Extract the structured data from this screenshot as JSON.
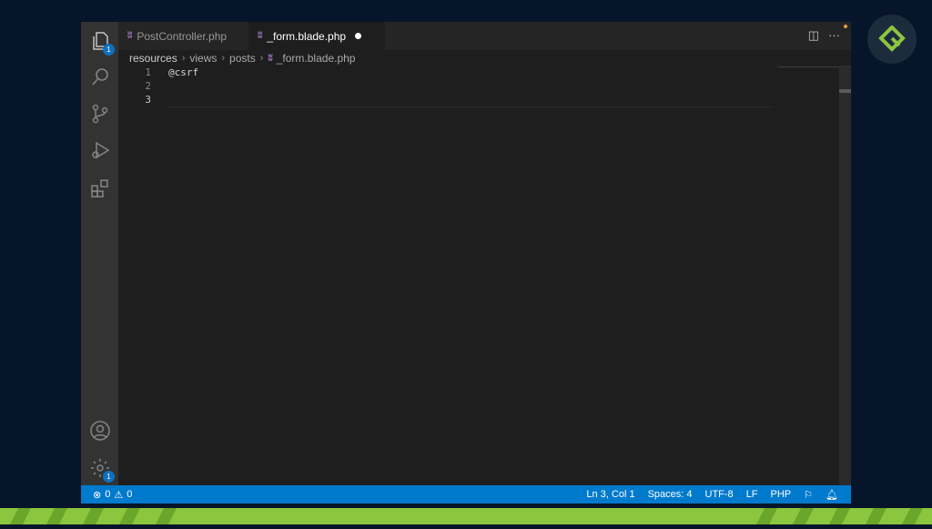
{
  "tabs": [
    {
      "icon": "php-elephant-icon",
      "label": "PostController.php",
      "active": false
    },
    {
      "icon": "php-elephant-icon",
      "label": "_form.blade.php",
      "active": true,
      "dirty": true
    }
  ],
  "breadcrumb": [
    "resources",
    "views",
    "posts",
    "_form.blade.php"
  ],
  "editor": {
    "line_numbers": [
      "1",
      "2",
      "3"
    ],
    "lines": [
      "@csrf",
      "",
      ""
    ],
    "current_line": 3
  },
  "activity_bar": {
    "explorer_badge": "1",
    "settings_badge": "1"
  },
  "status_bar": {
    "errors": "0",
    "warnings": "0",
    "position": "Ln 3, Col 1",
    "spaces": "Spaces: 4",
    "encoding": "UTF-8",
    "eol": "LF",
    "language": "PHP"
  },
  "colors": {
    "accent": "#007acc",
    "brand_green": "#8cc63f",
    "php_icon": "#a074c4"
  }
}
